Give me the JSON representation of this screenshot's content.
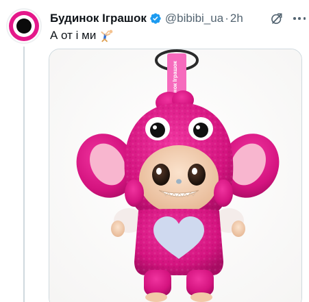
{
  "tweet": {
    "display_name": "Будинок Іграшок",
    "handle": "@bibibi_ua",
    "separator": "·",
    "time": "2h",
    "text": "А от і ми",
    "emoji": "person-doing-cartwheel",
    "verified": true,
    "media": {
      "tag_text": "Будинок Іграшок",
      "alt_subject": "pink-fluffy-toy-keychain"
    }
  },
  "colors": {
    "brand_pink": "#e4188a",
    "verified_blue": "#1d9bf0",
    "muted_text": "#536471",
    "border": "#cfd9de"
  }
}
